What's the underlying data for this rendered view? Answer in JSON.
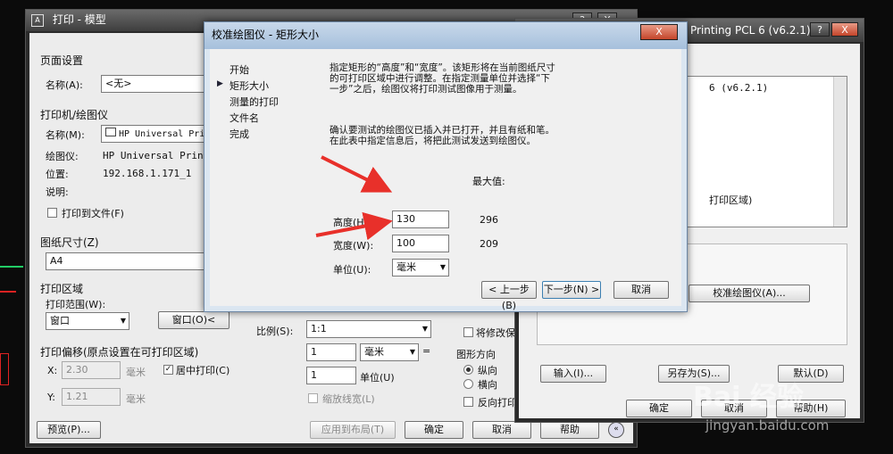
{
  "print_dialog": {
    "title": "打印 - 模型",
    "help_btn": "?",
    "close_btn": "X",
    "page_setup": {
      "heading": "页面设置",
      "name_label": "名称(A):",
      "name_value": "<无>"
    },
    "plotter": {
      "heading": "打印机/绘图仪",
      "name_label": "名称(M):",
      "name_value": "HP Universal Print",
      "plotter_label": "绘图仪:",
      "plotter_value": "HP Universal Printing",
      "location_label": "位置:",
      "location_value": "192.168.1.171_1",
      "desc_label": "说明:",
      "print_to_file": "打印到文件(F)"
    },
    "paper_size": {
      "heading": "图纸尺寸(Z)",
      "value": "A4"
    },
    "plot_area": {
      "heading": "打印区域",
      "range_label": "打印范围(W):",
      "range_value": "窗口",
      "window_btn": "窗口(O)<"
    },
    "plot_offset": {
      "heading": "打印偏移(原点设置在可打印区域)",
      "x_label": "X:",
      "x_value": "2.30",
      "x_unit": "毫米",
      "y_label": "Y:",
      "y_value": "1.21",
      "y_unit": "毫米",
      "center": "居中打印(C)"
    },
    "scale": {
      "label": "比例(S):",
      "value": "1:1",
      "value1": "1",
      "unit1": "毫米",
      "eq": "=",
      "value2": "1",
      "unit2": "单位(U)",
      "lineweight": "缩放线宽(L)"
    },
    "side": {
      "save_changes": "将修改保",
      "orientation": "图形方向",
      "portrait": "纵向",
      "landscape": "横向",
      "upside_down": "反向打印"
    },
    "buttons": {
      "preview": "预览(P)...",
      "apply_layout": "应用到布局(T)",
      "ok": "确定",
      "cancel": "取消",
      "help": "帮助"
    }
  },
  "plotter_editor": {
    "title": "Printing PCL 6 (v6.2.1)",
    "help_btn": "?",
    "close_btn": "X",
    "list_item1": "6 (v6.2.1)",
    "list_item2": "打印区域)",
    "calibrate_btn": "校准绘图仪(A)...",
    "import_btn": "输入(I)...",
    "saveas_btn": "另存为(S)...",
    "default_btn": "默认(D)",
    "ok_btn": "确定",
    "cancel_btn": "取消",
    "help_btn2": "帮助(H)"
  },
  "wizard": {
    "title": "校准绘图仪 - 矩形大小",
    "close_btn": "X",
    "steps": [
      "开始",
      "矩形大小",
      "测量的打印",
      "文件名",
      "完成"
    ],
    "current_marker": "▶",
    "instruction1": "指定矩形的“高度”和“宽度”。该矩形将在当前图纸尺寸的可打印区域中进行调整。在指定测量单位并选择“下一步”之后，绘图仪将打印测试图像用于测量。",
    "instruction2": "确认要测试的绘图仪已插入并已打开，并且有纸和笔。在此表中指定信息后，将把此测试发送到绘图仪。",
    "max_label": "最大值:",
    "height_label": "高度(H):",
    "height_value": "130",
    "height_max": "296",
    "width_label": "宽度(W):",
    "width_value": "100",
    "width_max": "209",
    "unit_label": "单位(U):",
    "unit_value": "毫米",
    "back_btn": "< 上一步(B)",
    "next_btn": "下一步(N) >",
    "cancel_btn": "取消"
  },
  "watermark": {
    "brand": "Bai 经验",
    "url": "jingyan.baidu.com"
  },
  "colors": {
    "arrow": "#e8302a",
    "wizard_title": "#b8cde4",
    "dialog_bg": "#f0f0f0"
  }
}
